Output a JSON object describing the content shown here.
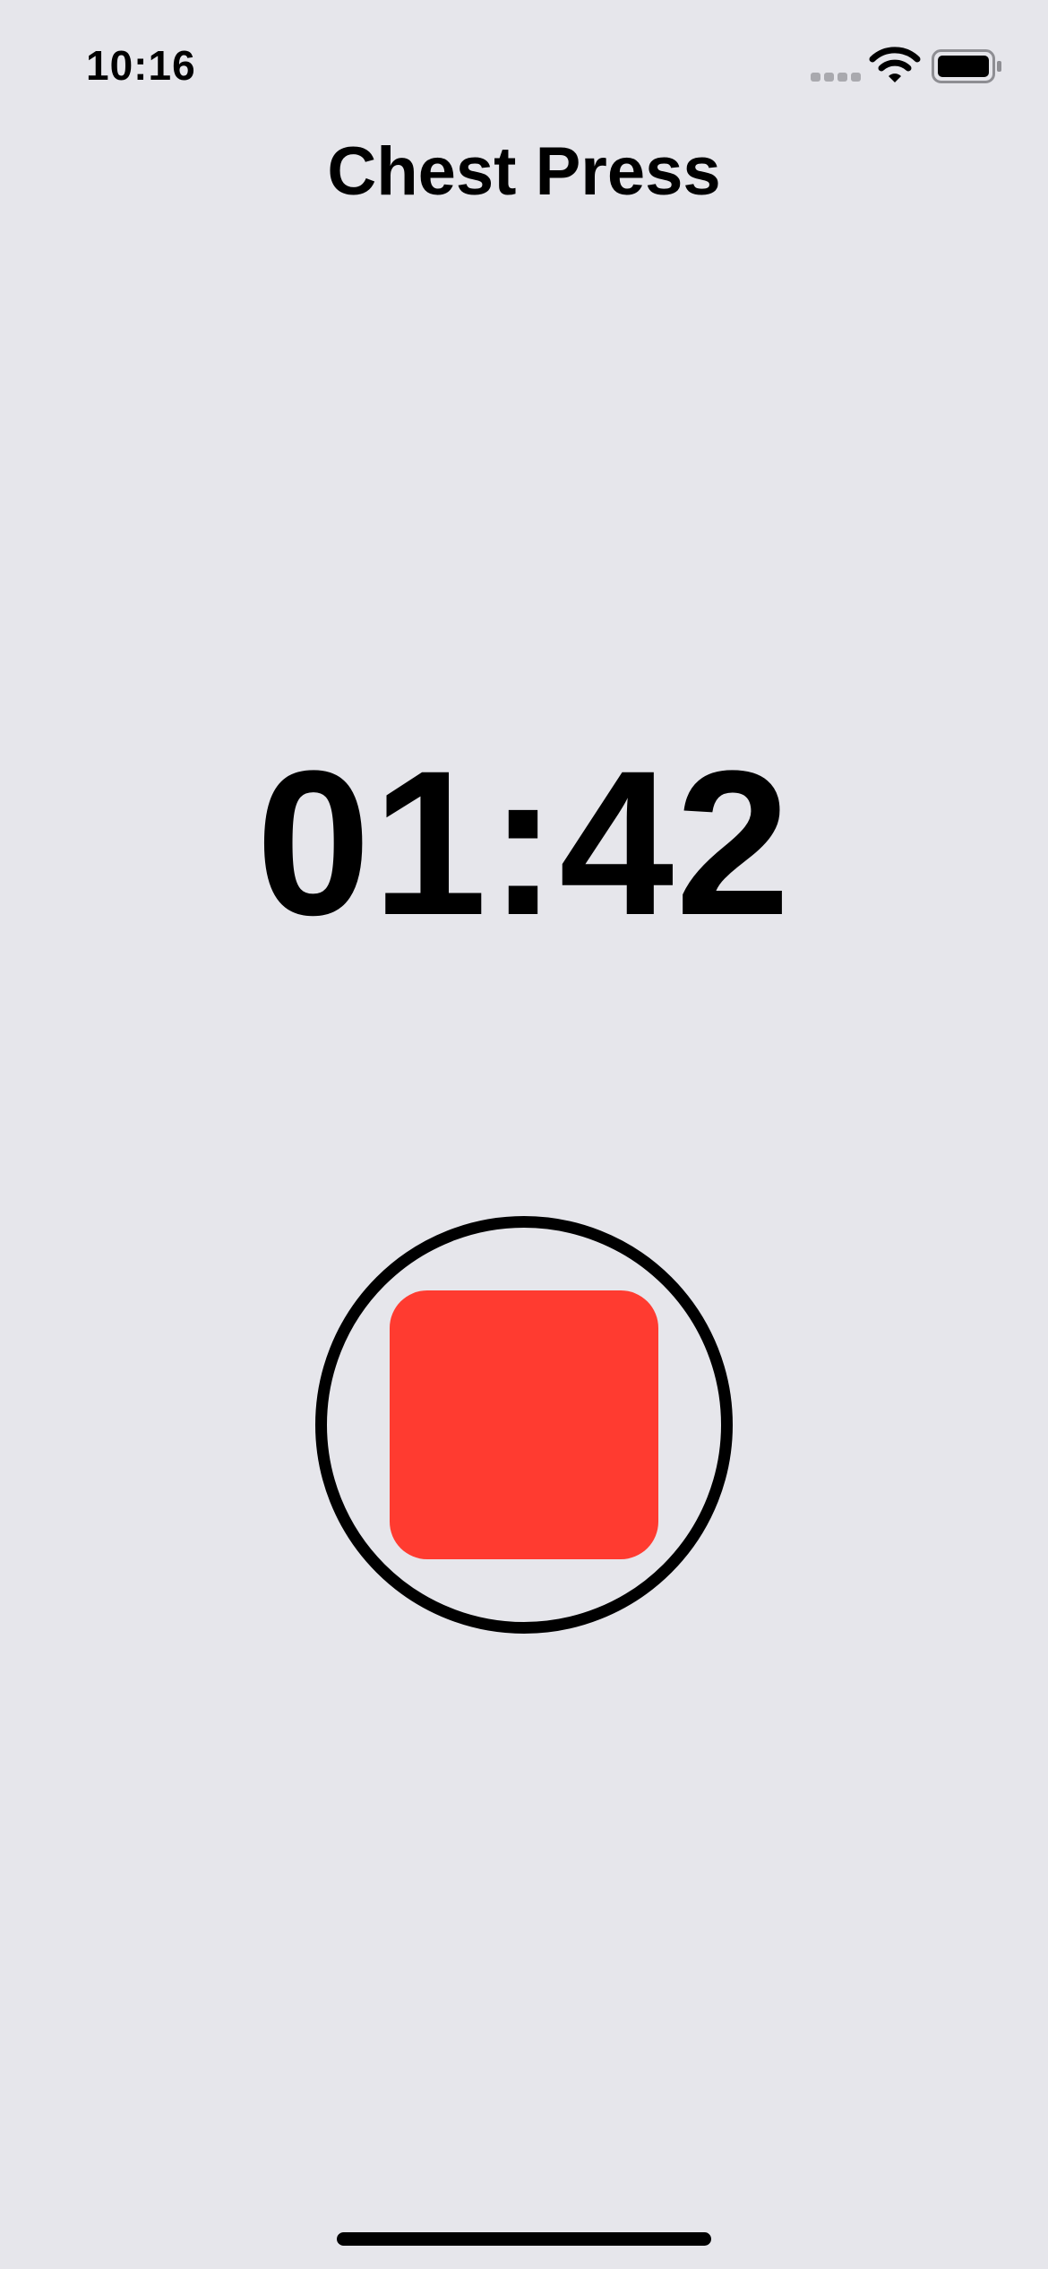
{
  "status_bar": {
    "time": "10:16",
    "icons": [
      "signal-dots-icon",
      "wifi-icon",
      "battery-icon"
    ]
  },
  "header": {
    "title": "Chest Press"
  },
  "timer": {
    "value": "01:42"
  },
  "controls": {
    "stop_button_icon": "stop-icon"
  },
  "colors": {
    "background": "#e6e6eb",
    "stop_accent": "#ff3b30",
    "text": "#000000"
  }
}
